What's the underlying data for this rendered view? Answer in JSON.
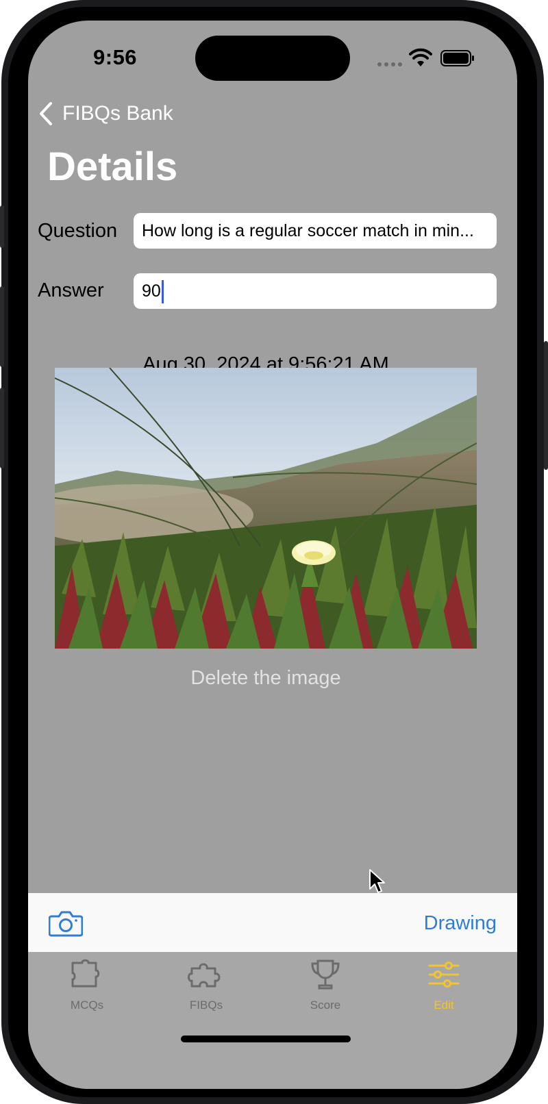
{
  "status_bar": {
    "time": "9:56"
  },
  "nav": {
    "back_label": "FIBQs Bank",
    "title": "Details"
  },
  "form": {
    "question_label": "Question",
    "question_value": "How long is a regular soccer match in min...",
    "answer_label": "Answer",
    "answer_value": "90"
  },
  "timestamp": "Aug 30, 2024 at 9:56:21 AM",
  "image": {
    "subject": "flower-photo"
  },
  "delete_label": "Delete the image",
  "toolbar": {
    "camera_icon": "camera-icon",
    "drawing_label": "Drawing"
  },
  "tabs": [
    {
      "label": "MCQs",
      "icon": "puzzle-piece-icon",
      "active": false
    },
    {
      "label": "FIBQs",
      "icon": "puzzle-outline-icon",
      "active": false
    },
    {
      "label": "Score",
      "icon": "trophy-icon",
      "active": false
    },
    {
      "label": "Edit",
      "icon": "sliders-icon",
      "active": true
    }
  ],
  "colors": {
    "screen_background": "#9f9f9f",
    "accent_blue": "#2f7dd5",
    "active_tab": "#f3c432",
    "inactive_tab": "#6b6b6b"
  }
}
